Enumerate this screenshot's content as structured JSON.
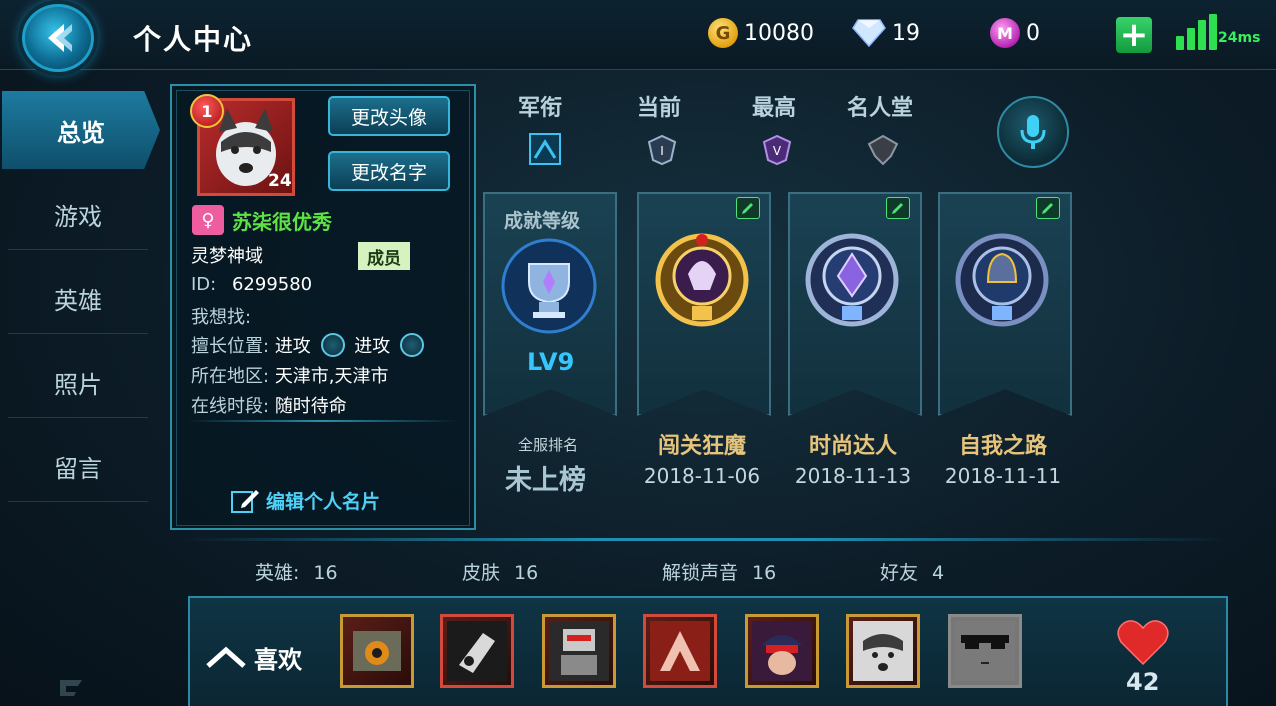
{
  "header": {
    "title": "个人中心",
    "gold": "10080",
    "diamonds": "19",
    "gems": "0",
    "ping": "24ms"
  },
  "sidebar": {
    "items": [
      {
        "label": "总览",
        "active": true
      },
      {
        "label": "游戏",
        "active": false
      },
      {
        "label": "英雄",
        "active": false
      },
      {
        "label": "照片",
        "active": false
      },
      {
        "label": "留言",
        "active": false
      }
    ]
  },
  "profile": {
    "badge_level": "1",
    "avatar_level": "24",
    "change_avatar_label": "更改头像",
    "change_name_label": "更改名字",
    "nickname": "苏柒很优秀",
    "guild": "灵梦神域",
    "guild_role": "成员",
    "id_label": "ID:",
    "id_value": "6299580",
    "looking_for_label": "我想找:",
    "position_label": "擅长位置:",
    "position_1": "进攻",
    "position_2": "进攻",
    "region_label": "所在地区:",
    "region_value": "天津市,天津市",
    "online_label": "在线时段:",
    "online_value": "随时待命",
    "edit_card_label": "编辑个人名片"
  },
  "ranks": {
    "headers": [
      "军衔",
      "当前",
      "最高",
      "名人堂"
    ]
  },
  "achievements": {
    "level_title": "成就等级",
    "level_value": "LV9",
    "rank_label": "全服排名",
    "rank_value": "未上榜",
    "items": [
      {
        "name": "闯关狂魔",
        "date": "2018-11-06"
      },
      {
        "name": "时尚达人",
        "date": "2018-11-13"
      },
      {
        "name": "自我之路",
        "date": "2018-11-11"
      }
    ]
  },
  "stats": {
    "heroes_label": "英雄:",
    "heroes_value": "16",
    "skins_label": "皮肤",
    "skins_value": "16",
    "voices_label": "解锁声音",
    "voices_value": "16",
    "friends_label": "好友",
    "friends_value": "4"
  },
  "likes": {
    "label": "喜欢",
    "count": "42"
  },
  "colors": {
    "accent": "#2b8fa8",
    "nickname": "#5ee245",
    "achievement_title": "#e6c47c",
    "level": "#36c6ff"
  }
}
